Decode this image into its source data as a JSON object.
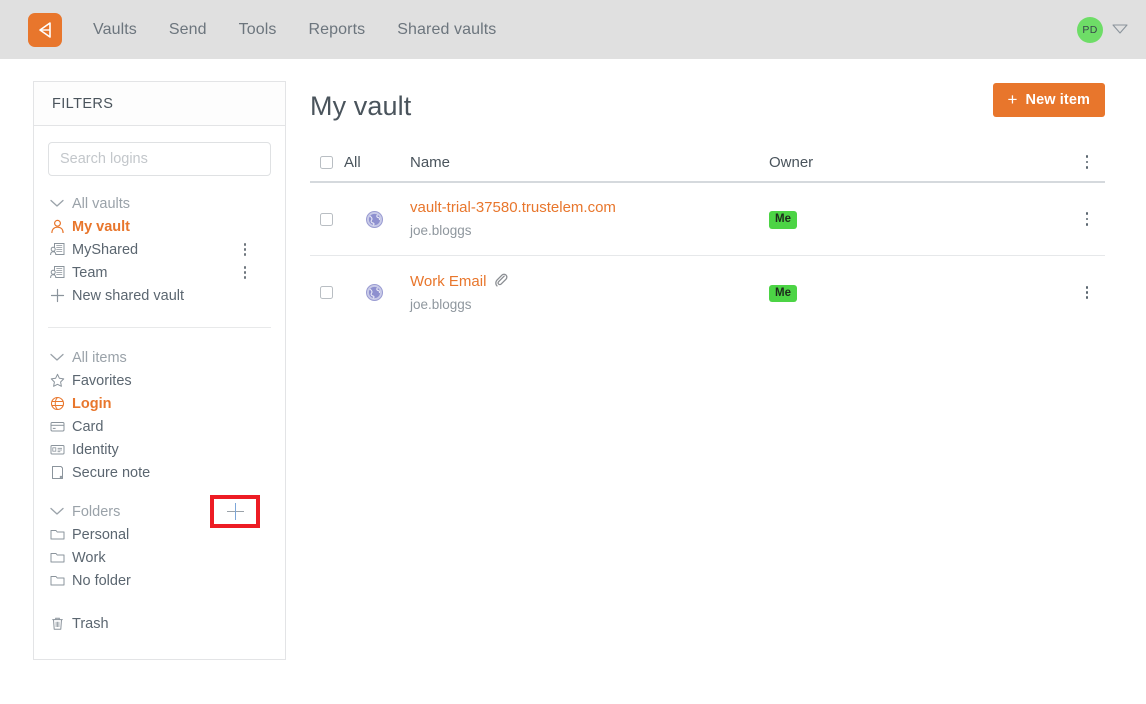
{
  "topbar": {
    "logo_icon": "devolutions-logo-icon",
    "nav_items": [
      {
        "label": "Vaults"
      },
      {
        "label": "Send"
      },
      {
        "label": "Tools"
      },
      {
        "label": "Reports"
      },
      {
        "label": "Shared vaults"
      }
    ],
    "avatar_initials": "PD",
    "avatar_color": "#6edd67",
    "caret_icon": "chevron-down-icon"
  },
  "sidebar": {
    "title": "FILTERS",
    "search": {
      "placeholder": "Search logins",
      "value": ""
    },
    "vaults_group": {
      "header": {
        "label": "All vaults",
        "icon": "chevron-down-icon"
      },
      "items": [
        {
          "label": "My vault",
          "icon": "person-icon",
          "active": true,
          "kebab": false
        },
        {
          "label": "MyShared",
          "icon": "shared-vault-icon",
          "active": false,
          "kebab": true
        },
        {
          "label": "Team",
          "icon": "shared-vault-icon",
          "active": false,
          "kebab": true
        },
        {
          "label": "New shared vault",
          "icon": "plus-icon",
          "active": false,
          "kebab": false
        }
      ]
    },
    "items_group": {
      "header": {
        "label": "All items",
        "icon": "chevron-down-icon"
      },
      "items": [
        {
          "label": "Favorites",
          "icon": "star-icon",
          "active": false
        },
        {
          "label": "Login",
          "icon": "login-globe-icon",
          "active": true
        },
        {
          "label": "Card",
          "icon": "credit-card-icon",
          "active": false
        },
        {
          "label": "Identity",
          "icon": "identity-icon",
          "active": false
        },
        {
          "label": "Secure note",
          "icon": "note-icon",
          "active": false
        }
      ]
    },
    "folders_group": {
      "header": {
        "label": "Folders",
        "icon": "chevron-down-icon"
      },
      "add_button": {
        "icon": "plus-icon",
        "highlighted": true,
        "highlight_color": "#ed1c24"
      },
      "items": [
        {
          "label": "Personal",
          "icon": "folder-icon"
        },
        {
          "label": "Work",
          "icon": "folder-icon"
        },
        {
          "label": "No folder",
          "icon": "folder-icon"
        }
      ]
    },
    "trash": {
      "label": "Trash",
      "icon": "trash-icon"
    }
  },
  "main": {
    "page_title": "My vault",
    "new_item_button": {
      "label": "New item",
      "plus": "+",
      "color": "#e8762c"
    },
    "table": {
      "headers": {
        "all": "All",
        "name": "Name",
        "owner": "Owner"
      },
      "rows": [
        {
          "name": "vault-trial-37580.trustelem.com",
          "username": "joe.bloggs",
          "owner": "Me",
          "icon": "globe-favicon-icon",
          "attachment": false
        },
        {
          "name": "Work Email",
          "username": "joe.bloggs",
          "owner": "Me",
          "icon": "globe-favicon-icon",
          "attachment": true,
          "attachment_icon": "paperclip-icon"
        }
      ]
    }
  }
}
